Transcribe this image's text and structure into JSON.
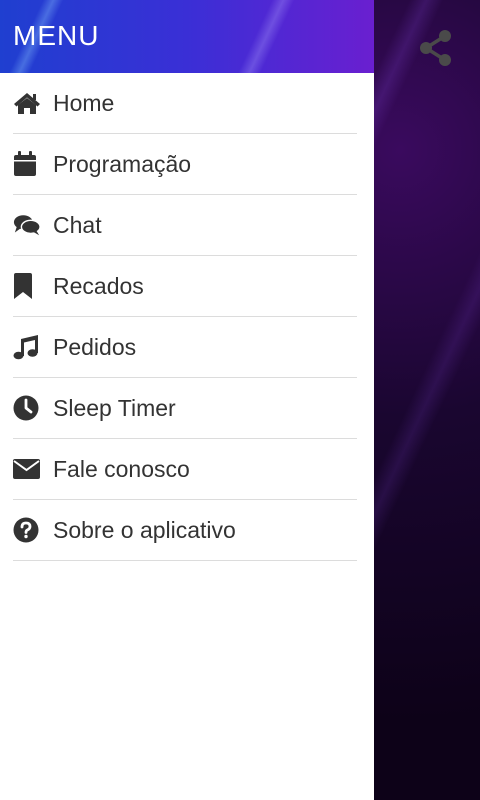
{
  "drawer": {
    "title": "MENU",
    "items": [
      {
        "label": "Home",
        "icon": "home-icon"
      },
      {
        "label": "Programação",
        "icon": "calendar-icon"
      },
      {
        "label": "Chat",
        "icon": "chat-icon"
      },
      {
        "label": "Recados",
        "icon": "bookmark-icon"
      },
      {
        "label": "Pedidos",
        "icon": "music-icon"
      },
      {
        "label": "Sleep Timer",
        "icon": "clock-icon"
      },
      {
        "label": "Fale conosco",
        "icon": "envelope-icon"
      },
      {
        "label": "Sobre o aplicativo",
        "icon": "question-icon"
      }
    ]
  },
  "app": {
    "share_icon": "share-icon"
  },
  "colors": {
    "header_start": "#1f3fd0",
    "header_end": "#6a1fd0",
    "text": "#333333",
    "divider": "#dcdcdc"
  }
}
